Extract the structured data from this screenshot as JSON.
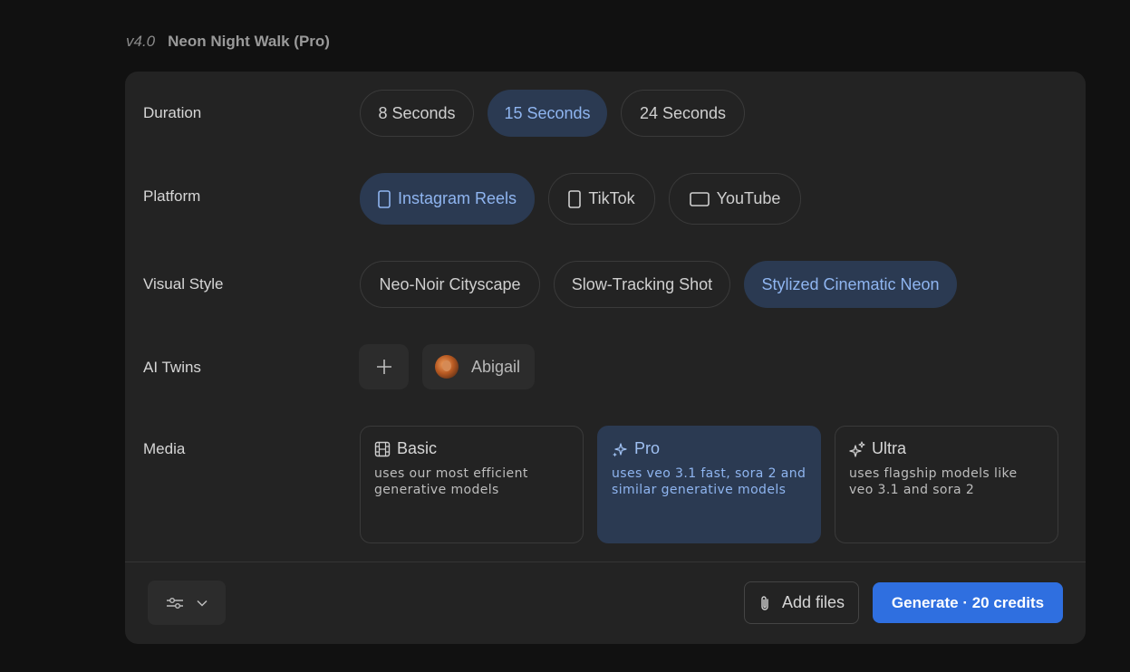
{
  "header": {
    "version": "v4.0",
    "project_name": "Neon Night Walk (Pro)"
  },
  "duration": {
    "label": "Duration",
    "options": [
      "8 Seconds",
      "15 Seconds",
      "24 Seconds"
    ],
    "selected": "15 Seconds"
  },
  "platform": {
    "label": "Platform",
    "options": [
      "Instagram Reels",
      "TikTok",
      "YouTube"
    ],
    "selected": "Instagram Reels"
  },
  "visual_style": {
    "label": "Visual Style",
    "options": [
      "Neo-Noir Cityscape",
      "Slow-Tracking Shot",
      "Stylized Cinematic Neon"
    ],
    "selected": "Stylized Cinematic Neon"
  },
  "ai_twins": {
    "label": "AI Twins",
    "twins": [
      "Abigail"
    ]
  },
  "media": {
    "label": "Media",
    "tiers": [
      {
        "name": "Basic",
        "icon": "film-icon",
        "description": "uses our most efficient generative models"
      },
      {
        "name": "Pro",
        "icon": "sparkles-icon",
        "description": "uses veo 3.1 fast, sora 2 and similar generative models"
      },
      {
        "name": "Ultra",
        "icon": "sparkles-icon",
        "description": "uses flagship models like veo 3.1 and sora 2"
      }
    ],
    "selected": "Pro"
  },
  "footer": {
    "add_files_label": "Add files",
    "generate_label": "Generate · 20 credits"
  },
  "colors": {
    "accent": "#2f6fe0",
    "selected_bg": "#2b3a52",
    "selected_text": "#8fb5f0"
  }
}
